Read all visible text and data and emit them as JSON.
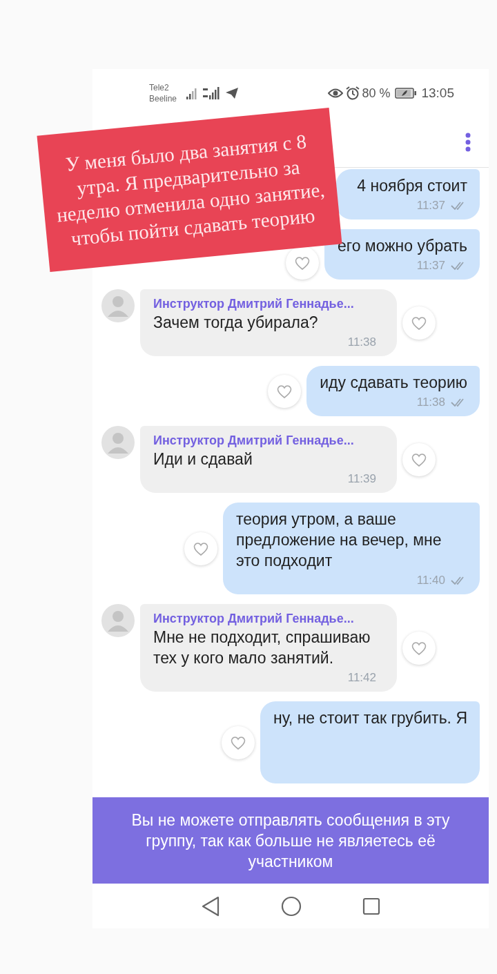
{
  "status_bar": {
    "carriers": [
      "Tele2",
      "Beeline"
    ],
    "battery": "80 %",
    "time": "13:05"
  },
  "messages": [
    {
      "kind": "outgoing",
      "text": "4 ноября стоит",
      "time": "11:37"
    },
    {
      "kind": "outgoing",
      "text": "его можно убрать",
      "time": "11:37"
    },
    {
      "kind": "incoming",
      "sender": "Инструктор Дмитрий Геннадье...",
      "text": "Зачем тогда убирала?",
      "time": "11:38"
    },
    {
      "kind": "outgoing",
      "text": "иду сдавать теорию",
      "time": "11:38"
    },
    {
      "kind": "incoming",
      "sender": "Инструктор Дмитрий Геннадье...",
      "text": "Иди и сдавай",
      "time": "11:39"
    },
    {
      "kind": "outgoing",
      "text": "теория утром, а ваше предложение на вечер, мне это подходит",
      "time": "11:40"
    },
    {
      "kind": "incoming",
      "sender": "Инструктор Дмитрий Геннадье...",
      "text": "Мне не подходит, спрашиваю тех у кого мало занятий.",
      "time": "11:42"
    },
    {
      "kind": "outgoing",
      "text": "ну, не стоит так грубить. Я"
    }
  ],
  "banner": {
    "text": "Вы не можете отправлять сообщения в эту группу, так как больше не являетесь её участником"
  },
  "note": {
    "text": "У меня было два занятия с 8 утра. Я предварительно за неделю отменила одно занятие, чтобы пойти сдавать теорию"
  }
}
